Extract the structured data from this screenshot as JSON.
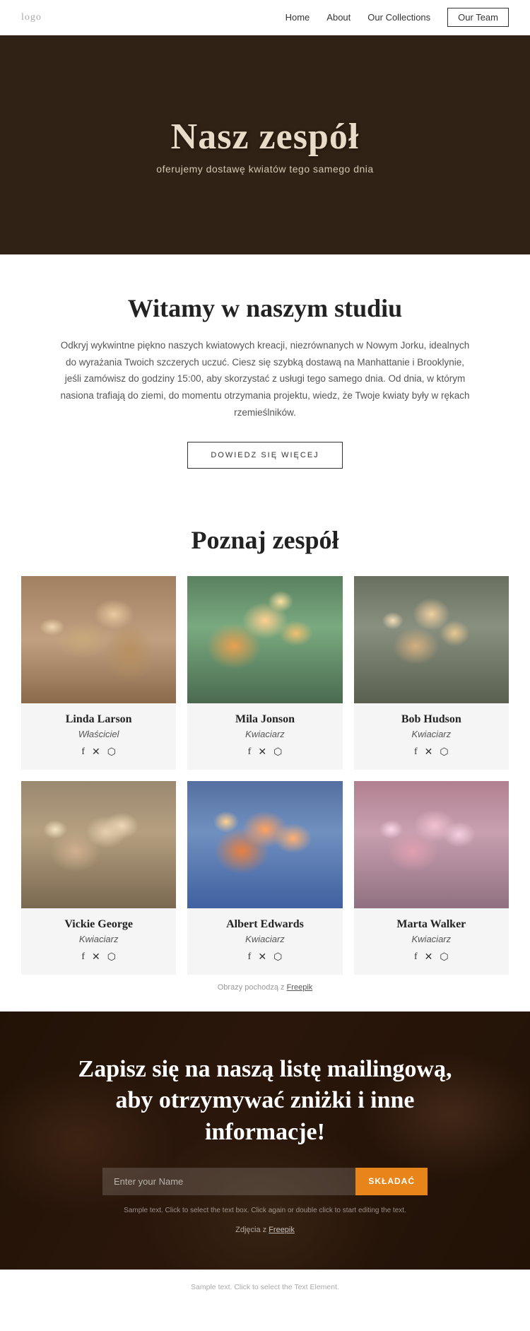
{
  "nav": {
    "logo": "logo",
    "links": [
      {
        "label": "Home",
        "id": "home"
      },
      {
        "label": "About",
        "id": "about"
      },
      {
        "label": "Our Collections",
        "id": "collections"
      },
      {
        "label": "Our Team",
        "id": "team",
        "isButton": true
      }
    ]
  },
  "hero": {
    "title": "Nasz zespół",
    "subtitle": "oferujemy dostawę kwiatów tego samego dnia"
  },
  "welcome": {
    "heading": "Witamy w naszym studiu",
    "body": "Odkryj wykwintne piękno naszych kwiatowych kreacji, niezrównanych w Nowym Jorku, idealnych do wyrażania Twoich szczerych uczuć. Ciesz się szybką dostawą na Manhattanie i Brooklynie, jeśli zamówisz do godziny 15:00, aby skorzystać z usługi tego samego dnia. Od dnia, w którym nasiona trafiają do ziemi, do momentu otrzymania projektu, wiedz, że Twoje kwiaty były w rękach rzemieślników.",
    "button_label": "DOWIEDZ SIĘ WIĘCEJ"
  },
  "team_section": {
    "heading": "Poznaj zespół",
    "members": [
      {
        "name": "Linda Larson",
        "role": "Właściciel",
        "photo_class": "photo-linda"
      },
      {
        "name": "Mila Jonson",
        "role": "Kwiaciarz",
        "photo_class": "photo-mila"
      },
      {
        "name": "Bob Hudson",
        "role": "Kwiaciarz",
        "photo_class": "photo-bob"
      },
      {
        "name": "Vickie George",
        "role": "Kwiaciarz",
        "photo_class": "photo-vickie"
      },
      {
        "name": "Albert Edwards",
        "role": "Kwiaciarz",
        "photo_class": "photo-albert"
      },
      {
        "name": "Marta Walker",
        "role": "Kwiaciarz",
        "photo_class": "photo-marta"
      }
    ],
    "social_icons": [
      "f",
      "𝕏",
      "🔲"
    ],
    "image_credit_prefix": "Obrazy pochodzą z ",
    "image_credit_link": "Freepik"
  },
  "newsletter": {
    "title": "Zapisz się na naszą listę mailingową, aby otrzymywać zniżki i inne informacje!",
    "input_placeholder": "Enter your Name",
    "button_label": "SKŁADAĆ",
    "sample_text": "Sample text. Click to select the text box. Click again or double click to start editing the text.",
    "photo_credit_prefix": "Zdjęcia z ",
    "photo_credit_link": "Freepik"
  },
  "footer": {
    "sample_text": "Sample text. Click to select the Text Element."
  }
}
